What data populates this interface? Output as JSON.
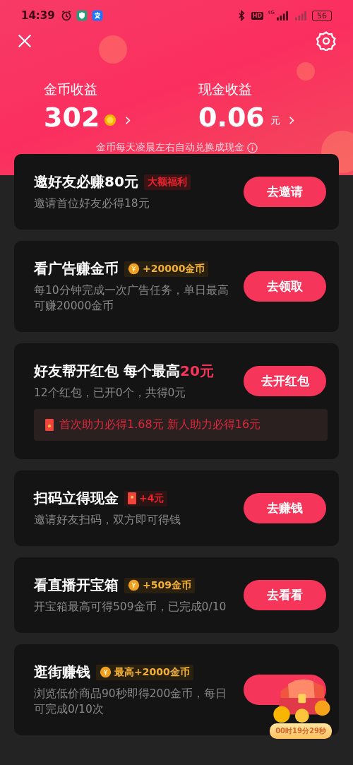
{
  "status_bar": {
    "time": "14:39",
    "hd": "HD",
    "network": "4G",
    "battery": "56"
  },
  "earnings": [
    {
      "label": "金币收益",
      "value": "302",
      "kind": "coin"
    },
    {
      "label": "现金收益",
      "value": "0.06",
      "unit": "元",
      "kind": "cash"
    }
  ],
  "note": "金币每天凌晨左右自动兑换成现金",
  "tasks": [
    {
      "title": "邀好友必赚80元",
      "badge": {
        "kind": "tag",
        "text": "大额福利"
      },
      "desc": "邀请首位好友必得18元",
      "button": "去邀请"
    },
    {
      "title": "看广告赚金币",
      "badge": {
        "kind": "coin",
        "text": "+20000金币"
      },
      "desc": "每10分钟完成一次广告任务，单日最高可赚20000金币",
      "button": "去领取"
    },
    {
      "title": "好友帮开红包 每个最高",
      "title_highlight": "20元",
      "desc": "12个红包，已开0个，共得0元",
      "button": "去开红包",
      "tip": "首次助力必得1.68元 新人助力必得16元"
    },
    {
      "title": "扫码立得现金",
      "badge": {
        "kind": "packet",
        "text": "+4元"
      },
      "desc": "邀请好友扫码，双方即可得钱",
      "button": "去赚钱"
    },
    {
      "title": "看直播开宝箱",
      "badge": {
        "kind": "coin",
        "text": "+509金币"
      },
      "desc": "开宝箱最高可得509金币，已完成0/10",
      "button": "去看看"
    },
    {
      "title": "逛街赚钱",
      "badge": {
        "kind": "coin",
        "text": "最高+2000金币"
      },
      "desc": "浏览低价商品90秒即得200金币，每日可完成0/10次"
    }
  ],
  "chest_timer": "00时19分29秒"
}
